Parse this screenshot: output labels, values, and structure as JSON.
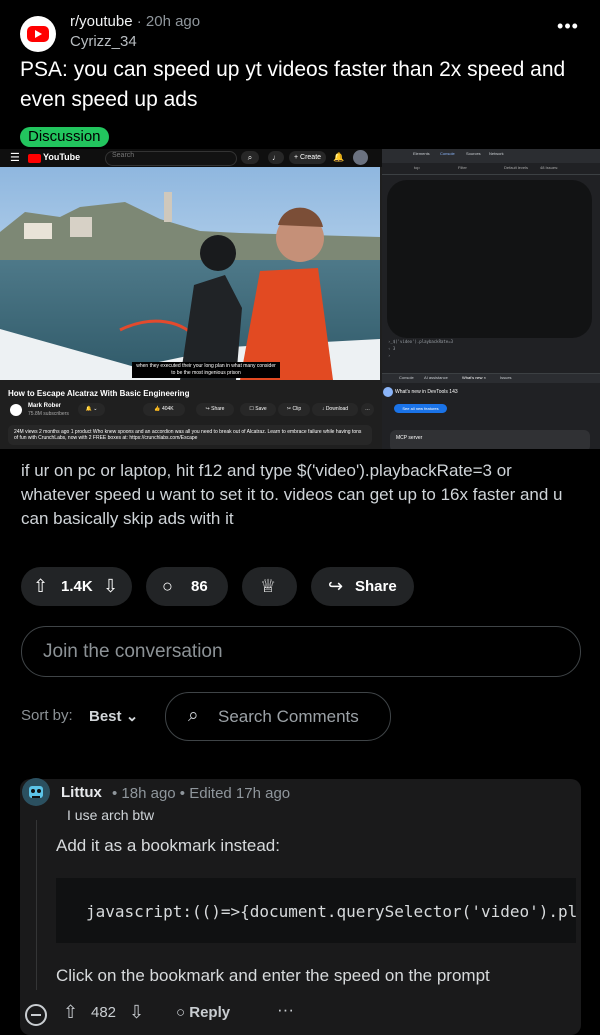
{
  "post": {
    "subreddit": "r/youtube",
    "age": "20h ago",
    "author": "Cyrizz_34",
    "title": "PSA: you can speed up yt videos faster than 2x speed and even speed up ads",
    "flair": "Discussion",
    "body": "if ur on pc or laptop, hit f12 and type $('video').playbackRate=3 or whatever speed u want to set it to. videos can get up to 16x faster and u can basically skip ads with it"
  },
  "screenshot": {
    "yt": {
      "logo_text": "YouTube",
      "search_placeholder": "Search",
      "create_label": "Create",
      "caption": "when they executed their your long plan in what many consider to be the most ingenious prison",
      "video_title": "How to Escape Alcatraz With Basic Engineering",
      "channel": "Mark Rober",
      "subscribers": "75.8M subscribers",
      "likes": "404K",
      "share": "Share",
      "save": "Save",
      "clip": "Clip",
      "download": "Download",
      "description": "24M views 2 months ago 1 product Who knew spoons and an accordion was all you need to break out of Alcatraz. Learn to embrace failure while having tons of fun with CrunchLabs, now with 2 FREE boxes at: https://crunchlabs.com/Escape"
    },
    "devtools": {
      "tabs": [
        "Elements",
        "Console",
        "Sources",
        "Network"
      ],
      "filter_top": "top",
      "filter_label": "Filter",
      "default_levels": "Default levels",
      "issues": "48 Issues:",
      "console_lines": [
        "›_$('video').playbackRate=3",
        "‹ 3",
        "›"
      ],
      "bottom_tabs": [
        "Console",
        "AI assistance",
        "What's new ×",
        "Issues"
      ],
      "whats_new": "What's new in DevTools 143",
      "see_all": "See all new features",
      "mcp": "MCP server"
    }
  },
  "actions": {
    "votes": "1.4K",
    "comments": "86",
    "share": "Share"
  },
  "composer": {
    "placeholder": "Join the conversation"
  },
  "sort": {
    "label": "Sort by:",
    "value": "Best",
    "search_placeholder": "Search Comments"
  },
  "comment": {
    "author": "Littux",
    "meta": "• 18h ago • Edited 17h ago",
    "flair": "I use arch btw",
    "body_1": "Add it as a bookmark instead:",
    "code": "javascript:(()=>{document.querySelector('video').playbackRate=prompt('Speed')})()",
    "body_2": "Click on the bookmark and enter the speed on the prompt",
    "score": "482",
    "reply": "Reply"
  }
}
